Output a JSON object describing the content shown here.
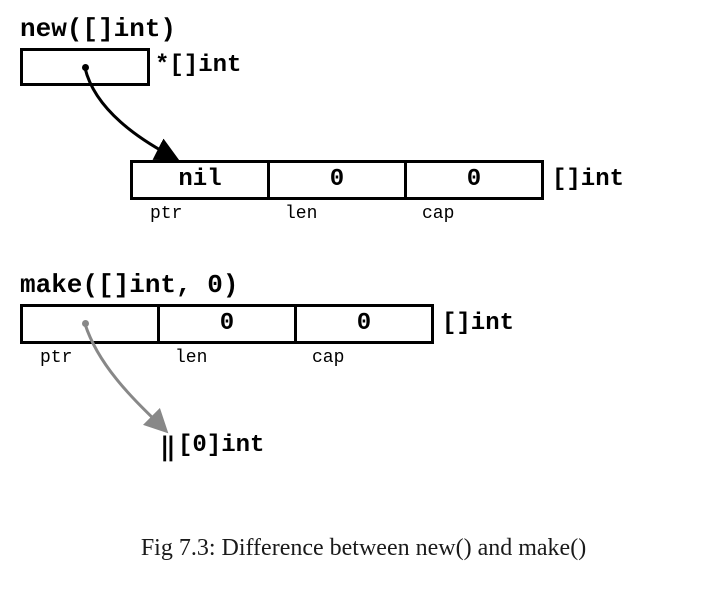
{
  "section_new": {
    "title": "new([]int)",
    "pointer_type": "*[]int",
    "slice": {
      "ptr_value": "nil",
      "len_value": "0",
      "cap_value": "0",
      "ptr_label": "ptr",
      "len_label": "len",
      "cap_label": "cap",
      "type_label": "[]int"
    }
  },
  "section_make": {
    "title": "make([]int, 0)",
    "slice": {
      "ptr_value": "",
      "len_value": "0",
      "cap_value": "0",
      "ptr_label": "ptr",
      "len_label": "len",
      "cap_label": "cap",
      "type_label": "[]int"
    },
    "array_label": "[0]int",
    "array_bar": "‖"
  },
  "caption": "Fig 7.3: Difference between new() and make()"
}
